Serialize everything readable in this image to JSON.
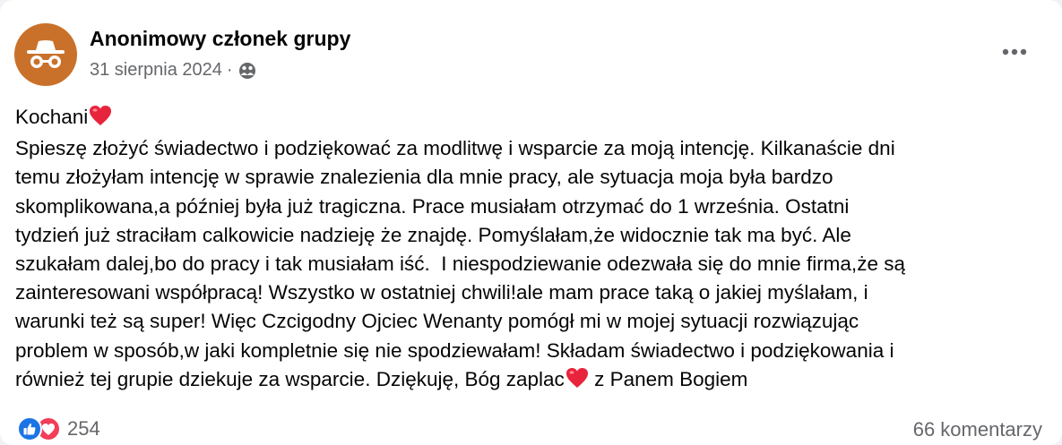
{
  "post": {
    "author": "Anonimowy członek grupy",
    "date": "31 sierpnia 2024",
    "separator": "·",
    "privacy_icon": "group-privacy-icon",
    "more_icon": "more-options-icon",
    "avatar_icon": "anonymous-incognito-icon",
    "lines": [
      "Kochani",
      "Spieszę złożyć świadectwo i podziękować za modlitwę i wsparcie za moją intencję. Kilkanaście dni",
      "temu złożyłam intencję w sprawie znalezienia dla mnie pracy, ale sytuacja moja była bardzo",
      "skomplikowana,a później była już tragiczna. Prace musiałam otrzymać do 1 września. Ostatni",
      "tydzień już straciłam calkowicie nadzieję że znajdę. Pomyślałam,że widocznie tak ma być. Ale",
      "szukałam dalej,bo do pracy i tak musiałam iść.  I niespodziewanie odezwała się do mnie firma,że są",
      "zainteresowani współpracą! Wszystko w ostatniej chwili!ale mam prace taką o jakiej myślałam, i",
      "warunki też są super! Więc Czcigodny Ojciec Wenanty pomógł mi w mojej sytuacji rozwiązując",
      "problem w sposób,w jaki kompletnie się nie spodziewałam! Składam świadectwo i podziękowania i",
      "również tej grupie dziekuje za wsparcie. Dziękuję, Bóg zaplac"
    ],
    "last_line_suffix": " z Panem Bogiem",
    "heart_emoji": "heart-emoji-icon"
  },
  "footer": {
    "reaction_icons": [
      "like-reaction-icon",
      "love-reaction-icon"
    ],
    "reaction_count": "254",
    "comments": "66 komentarzy"
  },
  "colors": {
    "author": "#050505",
    "meta": "#65676b",
    "avatar_bg": "#c9712a",
    "like_blue": "#1b74e4",
    "love_red": "#f33e58",
    "heart": "#e8243c"
  }
}
